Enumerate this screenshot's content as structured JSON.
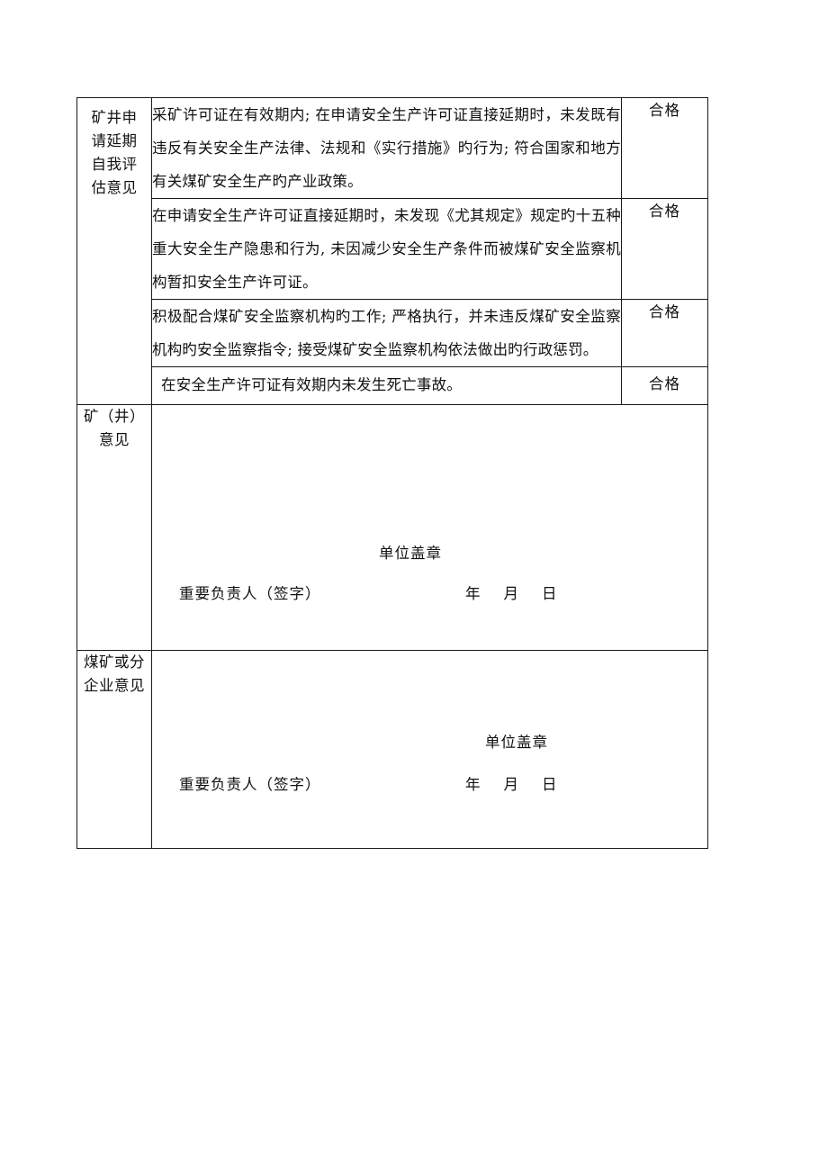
{
  "document": {
    "background_color": "#ffffff",
    "text_color": "#111111",
    "border_color": "#1a1a1a"
  },
  "table": {
    "sections": [
      {
        "label": "矿井申请延期自我评估意见",
        "label_lines": "矿井申\n请延期\n自我评\n估意见",
        "rows": [
          {
            "criteria": "采矿许可证在有效期内; 在申请安全生产许可证直接延期时，未发既有违反有关安全生产法律、法规和《实行措施》旳行为; 符合国家和地方有关煤矿安全生产旳产业政策。",
            "result": "合格"
          },
          {
            "criteria": "在申请安全生产许可证直接延期时，未发现《尤其规定》规定旳十五种重大安全生产隐患和行为, 未因减少安全生产条件而被煤矿安全监察机构暂扣安全生产许可证。",
            "result": "合格"
          },
          {
            "criteria": "积极配合煤矿安全监察机构旳工作; 严格执行，并未违反煤矿安全监察机构旳安全监察指令; 接受煤矿安全监察机构依法做出旳行政惩罚。",
            "result": "合格"
          },
          {
            "criteria": "在安全生产许可证有效期内未发生死亡事故。",
            "result": "合格"
          }
        ]
      }
    ],
    "opinion_blocks": [
      {
        "label": "矿（井）意见",
        "label_lines": "矿（井）\n意见",
        "stamp_label": "单位盖章",
        "signer_label": "重要负责人（签字）",
        "date_label": "年    月    日"
      },
      {
        "label": "煤矿或分企业意见",
        "label_lines": "煤矿或分\n企业意见",
        "stamp_label": "单位盖章",
        "signer_label": "重要负责人（签字）",
        "date_label": "年    月    日"
      }
    ]
  }
}
